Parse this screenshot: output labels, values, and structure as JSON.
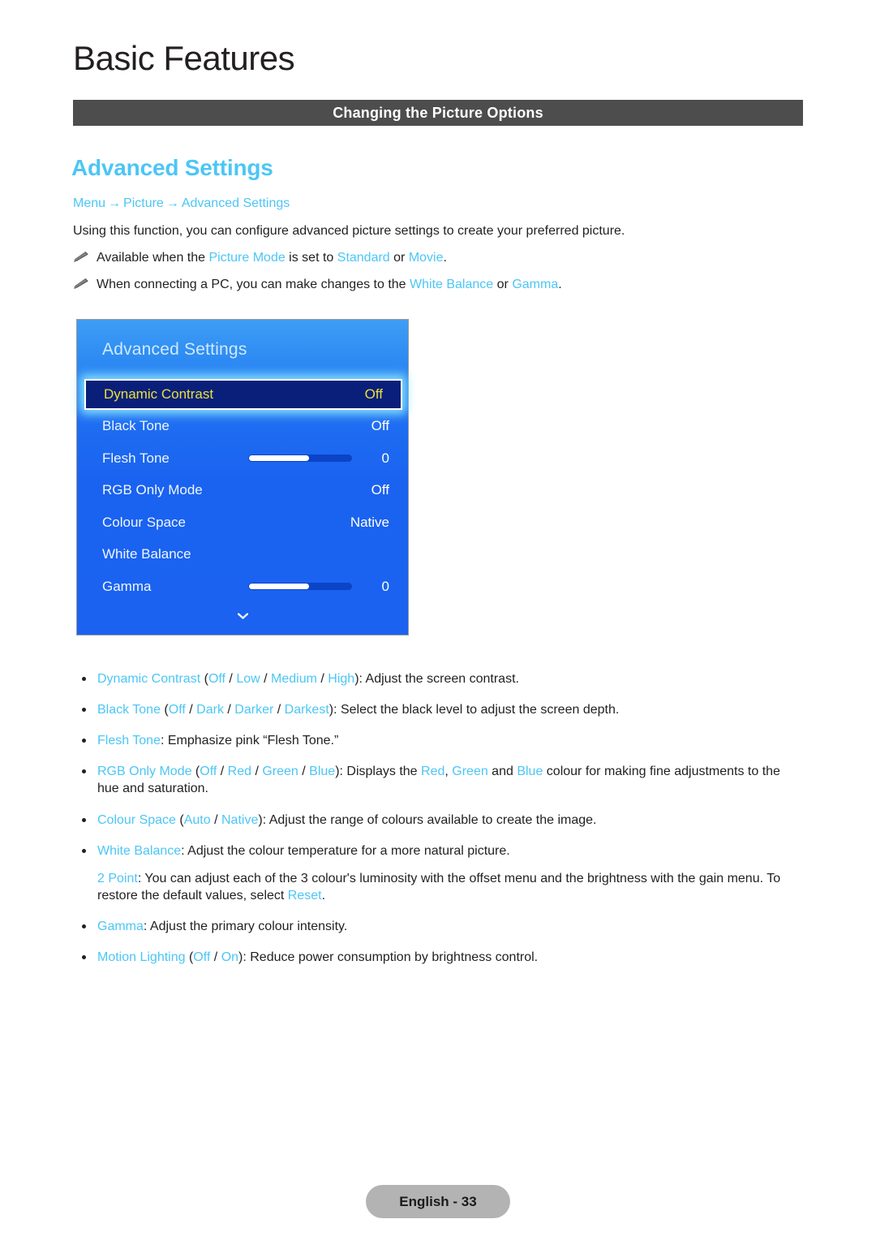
{
  "header": {
    "chapter_title": "Basic Features",
    "section_band_label": "Changing the Picture Options"
  },
  "content": {
    "feature_title": "Advanced Settings",
    "breadcrumb": {
      "item1": "Menu",
      "arrow1": "→",
      "item2": "Picture",
      "arrow2": "→",
      "item3": "Advanced Settings"
    },
    "intro_text": "Using this function, you can configure advanced picture settings to create your preferred picture.",
    "notes": [
      {
        "icon": "pencil-icon",
        "prefix": "Available when the ",
        "hl1": "Picture Mode",
        "mid1": " is set to ",
        "hl2": "Standard",
        "mid2": " or ",
        "hl3": "Movie",
        "suffix": "."
      },
      {
        "icon": "pencil-icon",
        "prefix": "When connecting a PC, you can make changes to the ",
        "hl1": "White Balance",
        "mid1": " or ",
        "hl2": "Gamma",
        "suffix": "."
      }
    ]
  },
  "osd": {
    "title": "Advanced Settings",
    "more_icon": "chevron-down-icon",
    "rows": [
      {
        "label": "Dynamic Contrast",
        "value": "Off",
        "type": "value",
        "selected": true
      },
      {
        "label": "Black Tone",
        "value": "Off",
        "type": "value",
        "selected": false
      },
      {
        "label": "Flesh Tone",
        "value": "0",
        "type": "slider",
        "selected": false,
        "fill_percent": 58
      },
      {
        "label": "RGB Only Mode",
        "value": "Off",
        "type": "value",
        "selected": false
      },
      {
        "label": "Colour Space",
        "value": "Native",
        "type": "value",
        "selected": false
      },
      {
        "label": "White Balance",
        "value": "",
        "type": "value",
        "selected": false
      },
      {
        "label": "Gamma",
        "value": "0",
        "type": "slider",
        "selected": false,
        "fill_percent": 58
      }
    ],
    "colors": {
      "panel_top": "#3e9ef5",
      "panel_bottom": "#1b62f1",
      "selected_bg": "#0a1f7a",
      "selected_text": "#e8e03a",
      "glow": "#8cebff"
    }
  },
  "descriptions": [
    {
      "marker": true,
      "parts": [
        {
          "t": "Dynamic Contrast",
          "c": "hl"
        },
        {
          "t": " (",
          "c": ""
        },
        {
          "t": "Off",
          "c": "hl"
        },
        {
          "t": " / ",
          "c": ""
        },
        {
          "t": "Low",
          "c": "hl"
        },
        {
          "t": " / ",
          "c": ""
        },
        {
          "t": "Medium",
          "c": "hl"
        },
        {
          "t": " / ",
          "c": ""
        },
        {
          "t": "High",
          "c": "hl"
        },
        {
          "t": "): Adjust the screen contrast.",
          "c": ""
        }
      ]
    },
    {
      "marker": true,
      "parts": [
        {
          "t": "Black Tone",
          "c": "hl"
        },
        {
          "t": " (",
          "c": ""
        },
        {
          "t": "Off",
          "c": "hl"
        },
        {
          "t": " / ",
          "c": ""
        },
        {
          "t": "Dark",
          "c": "hl"
        },
        {
          "t": " / ",
          "c": ""
        },
        {
          "t": "Darker",
          "c": "hl"
        },
        {
          "t": " / ",
          "c": ""
        },
        {
          "t": "Darkest",
          "c": "hl"
        },
        {
          "t": "): Select the black level to adjust the screen depth.",
          "c": ""
        }
      ]
    },
    {
      "marker": true,
      "parts": [
        {
          "t": "Flesh Tone",
          "c": "hl"
        },
        {
          "t": ": Emphasize pink “Flesh Tone.”",
          "c": ""
        }
      ]
    },
    {
      "marker": true,
      "parts": [
        {
          "t": "RGB Only Mode",
          "c": "hl"
        },
        {
          "t": " (",
          "c": ""
        },
        {
          "t": "Off",
          "c": "hl"
        },
        {
          "t": " / ",
          "c": ""
        },
        {
          "t": "Red",
          "c": "hl"
        },
        {
          "t": " / ",
          "c": ""
        },
        {
          "t": "Green",
          "c": "hl"
        },
        {
          "t": " / ",
          "c": ""
        },
        {
          "t": "Blue",
          "c": "hl"
        },
        {
          "t": "): Displays the ",
          "c": ""
        },
        {
          "t": "Red",
          "c": "hl"
        },
        {
          "t": ", ",
          "c": ""
        },
        {
          "t": "Green",
          "c": "hl"
        },
        {
          "t": " and ",
          "c": ""
        },
        {
          "t": "Blue",
          "c": "hl"
        },
        {
          "t": " colour for making fine adjustments to the hue and saturation.",
          "c": ""
        }
      ]
    },
    {
      "marker": true,
      "parts": [
        {
          "t": "Colour Space",
          "c": "hl"
        },
        {
          "t": " (",
          "c": ""
        },
        {
          "t": "Auto",
          "c": "hl"
        },
        {
          "t": " / ",
          "c": ""
        },
        {
          "t": "Native",
          "c": "hl"
        },
        {
          "t": "): Adjust the range of colours available to create the image.",
          "c": ""
        }
      ]
    },
    {
      "marker": true,
      "parts": [
        {
          "t": "White Balance",
          "c": "hl"
        },
        {
          "t": ": Adjust the colour temperature for a more natural picture.",
          "c": ""
        }
      ]
    },
    {
      "marker": false,
      "parts": [
        {
          "t": "2 Point",
          "c": "hl"
        },
        {
          "t": ": You can adjust each of the 3 colour's luminosity with the offset menu and the brightness with the gain menu. To restore the default values, select ",
          "c": ""
        },
        {
          "t": "Reset",
          "c": "hl"
        },
        {
          "t": ".",
          "c": ""
        }
      ]
    },
    {
      "marker": true,
      "parts": [
        {
          "t": "Gamma",
          "c": "hl"
        },
        {
          "t": ": Adjust the primary colour intensity.",
          "c": ""
        }
      ]
    },
    {
      "marker": true,
      "parts": [
        {
          "t": "Motion Lighting",
          "c": "hl"
        },
        {
          "t": " (",
          "c": ""
        },
        {
          "t": "Off",
          "c": "hl"
        },
        {
          "t": " / ",
          "c": ""
        },
        {
          "t": "On",
          "c": "hl"
        },
        {
          "t": "): Reduce power consumption by brightness control.",
          "c": ""
        }
      ]
    }
  ],
  "footer": {
    "page_label": "English - 33"
  }
}
